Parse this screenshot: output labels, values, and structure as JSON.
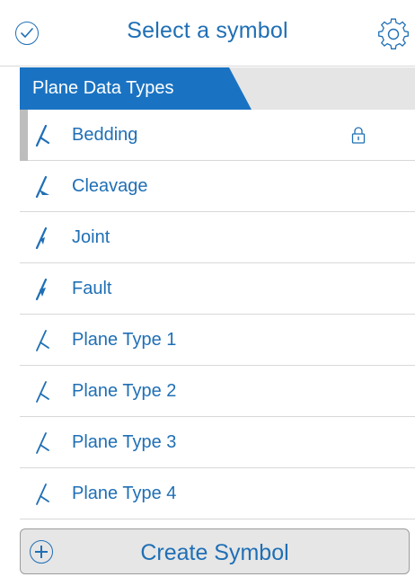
{
  "header": {
    "title": "Select a symbol",
    "left_icon": "checkmark-circle-icon",
    "right_icon": "gear-icon"
  },
  "section": {
    "label": "Plane Data Types"
  },
  "list": {
    "items": [
      {
        "label": "Bedding",
        "icon": "plane-symbol-icon",
        "selected": true,
        "locked": true
      },
      {
        "label": "Cleavage",
        "icon": "plane-symbol-icon",
        "selected": false,
        "locked": false
      },
      {
        "label": "Joint",
        "icon": "plane-symbol-icon",
        "selected": false,
        "locked": false
      },
      {
        "label": "Fault",
        "icon": "plane-symbol-icon",
        "selected": false,
        "locked": false
      },
      {
        "label": "Plane Type 1",
        "icon": "plane-symbol-icon",
        "selected": false,
        "locked": false
      },
      {
        "label": "Plane Type 2",
        "icon": "plane-symbol-icon",
        "selected": false,
        "locked": false
      },
      {
        "label": "Plane Type 3",
        "icon": "plane-symbol-icon",
        "selected": false,
        "locked": false
      },
      {
        "label": "Plane Type 4",
        "icon": "plane-symbol-icon",
        "selected": false,
        "locked": false
      }
    ]
  },
  "footer": {
    "create_label": "Create Symbol",
    "create_icon": "plus-circle-icon"
  },
  "colors": {
    "accent": "#1f6fb5",
    "section_tab": "#1a73c2",
    "section_bar": "#e5e5e5",
    "selected_marker": "#bdbdbd",
    "button_bg": "#e6e6e6"
  }
}
